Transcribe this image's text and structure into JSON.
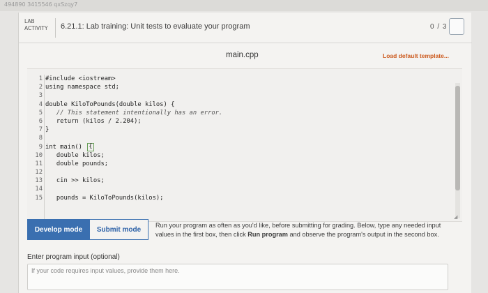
{
  "top_crumb": "494890 3415546 qxSzqy7",
  "activity": {
    "tag_line1": "LAB",
    "tag_line2": "ACTIVITY",
    "title": "6.21.1: Lab training: Unit tests to evaluate your program",
    "score": "0 / 3"
  },
  "editor": {
    "filename": "main.cpp",
    "load_default": "Load default template...",
    "lines": [
      {
        "n": "1",
        "code": "#include <iostream>"
      },
      {
        "n": "2",
        "code": "using namespace std;"
      },
      {
        "n": "3",
        "code": ""
      },
      {
        "n": "4",
        "code": "double KiloToPounds(double kilos) {"
      },
      {
        "n": "5",
        "code": "   // This statement intentionally has an error."
      },
      {
        "n": "6",
        "code": "   return (kilos / 2.204);"
      },
      {
        "n": "7",
        "code": "}"
      },
      {
        "n": "8",
        "code": ""
      },
      {
        "n": "9",
        "code": "int main() "
      },
      {
        "n": "10",
        "code": "   double kilos;"
      },
      {
        "n": "11",
        "code": "   double pounds;"
      },
      {
        "n": "12",
        "code": ""
      },
      {
        "n": "13",
        "code": "   cin >> kilos;"
      },
      {
        "n": "14",
        "code": ""
      },
      {
        "n": "15",
        "code": "   pounds = KiloToPounds(kilos);"
      }
    ],
    "brace": "{"
  },
  "modes": {
    "develop_label": "Develop mode",
    "submit_label": "Submit mode",
    "description_pre": "Run your program as often as you'd like, before submitting for grading. Below, type any needed input values in the first box, then click ",
    "description_bold": "Run program",
    "description_post": " and observe the program's output in the second box."
  },
  "input": {
    "label": "Enter program input (optional)",
    "placeholder": "If your code requires input values, provide them here."
  },
  "colors": {
    "accent": "#3a6fb0",
    "load_default": "#cc5a1e"
  }
}
